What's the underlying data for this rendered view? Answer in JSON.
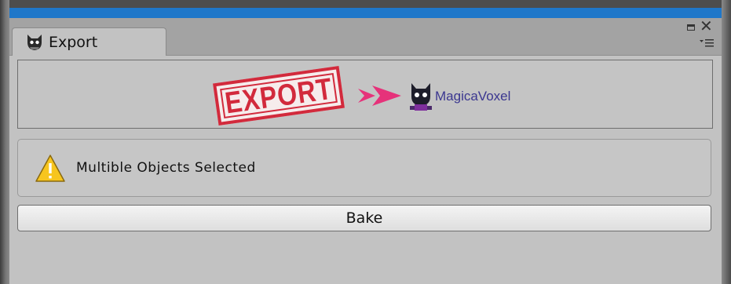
{
  "window": {
    "tab_title": "Export",
    "tab_icon": "cat-icon",
    "accent_bar_color": "#1f77c9",
    "controls": [
      "maximize-icon",
      "close-icon",
      "menu-icon"
    ]
  },
  "header": {
    "stamp_text": "EXPORT",
    "stamp_color": "#d22a3c",
    "arrow_color": "#e6327a",
    "target_label": "MagicaVoxel",
    "target_icon": "magicavoxel-icon"
  },
  "warning": {
    "icon": "warning-icon",
    "message": "Multible Objects Selected"
  },
  "actions": {
    "bake_label": "Bake"
  }
}
